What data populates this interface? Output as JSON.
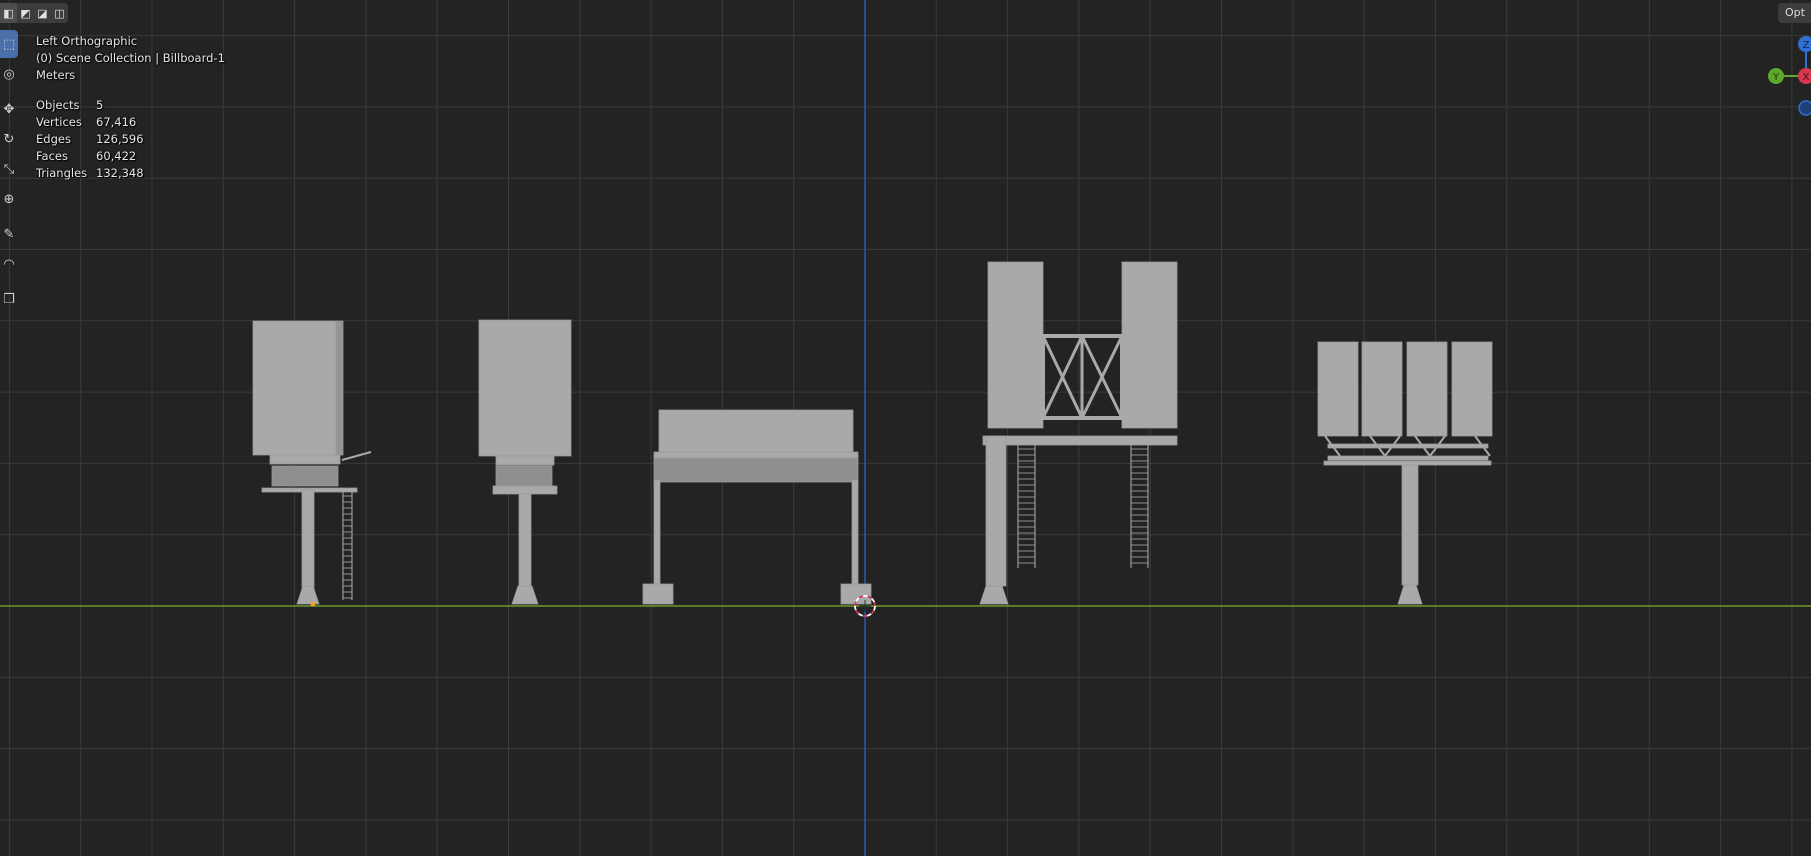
{
  "header": {
    "modes": [
      {
        "icon": "select-new-icon",
        "glyph": "◧",
        "active": true
      },
      {
        "icon": "select-extend-icon",
        "glyph": "◩",
        "active": false
      },
      {
        "icon": "select-subtract-icon",
        "glyph": "◪",
        "active": false
      },
      {
        "icon": "select-invert-icon",
        "glyph": "◫",
        "active": false
      }
    ],
    "options_label": "Opt"
  },
  "view": {
    "projection": "Left Orthographic",
    "collection": "(0) Scene Collection | Billboard-1",
    "units": "Meters"
  },
  "stats": [
    {
      "label": "Objects",
      "value": "5"
    },
    {
      "label": "Vertices",
      "value": "67,416"
    },
    {
      "label": "Edges",
      "value": "126,596"
    },
    {
      "label": "Faces",
      "value": "60,422"
    },
    {
      "label": "Triangles",
      "value": "132,348"
    }
  ],
  "toolbar": [
    {
      "icon": "select-box-icon",
      "glyph": "⬚",
      "active": true
    },
    {
      "icon": "cursor-icon",
      "glyph": "◎",
      "active": false
    },
    {
      "icon": "move-icon",
      "glyph": "✥",
      "active": false
    },
    {
      "icon": "rotate-icon",
      "glyph": "↻",
      "active": false
    },
    {
      "icon": "scale-icon",
      "glyph": "⤡",
      "active": false
    },
    {
      "icon": "transform-icon",
      "glyph": "⊕",
      "active": false
    },
    {
      "icon": "annotate-icon",
      "glyph": "✎",
      "active": false
    },
    {
      "icon": "measure-icon",
      "glyph": "◠",
      "active": false
    },
    {
      "icon": "add-cube-icon",
      "glyph": "❒",
      "active": false
    }
  ],
  "gizmo": {
    "z_label": "Z",
    "y_label": "Y",
    "x_label": "X",
    "z_color": "#2f6fd6",
    "y_color": "#5fa82b",
    "x_color": "#d9364f"
  },
  "colors": {
    "background": "#232323",
    "grid": "#3a3a3a",
    "grid_major": "#4a4a4a",
    "z_axis_line": "#2c5ba8",
    "ground_line": "#6b9a2a",
    "mesh": "#a9a9a9"
  }
}
